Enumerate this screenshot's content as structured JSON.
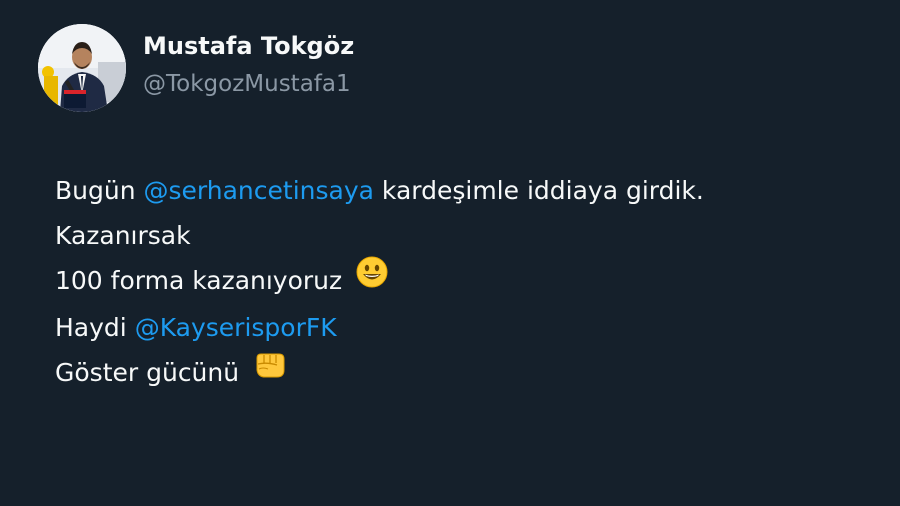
{
  "author": {
    "display_name": "Mustafa Tokgöz",
    "handle": "@TokgozMustafa1"
  },
  "tweet": {
    "line1_before": "Bugün ",
    "line1_mention": "@serhancetinsaya",
    "line1_after": " kardeşimle iddiaya girdik.",
    "line2": "Kazanırsak",
    "line3": "100 forma kazanıyoruz",
    "line3_emoji": "grinning-face-emoji",
    "line4_before": "Haydi ",
    "line4_mention": "@KayserisporFK",
    "line5": "Göster gücünü",
    "line5_emoji": "oncoming-fist-emoji"
  },
  "colors": {
    "background": "#15202b",
    "text": "#f7f9f9",
    "handle": "#8b98a5",
    "mention": "#1d9bf0"
  }
}
